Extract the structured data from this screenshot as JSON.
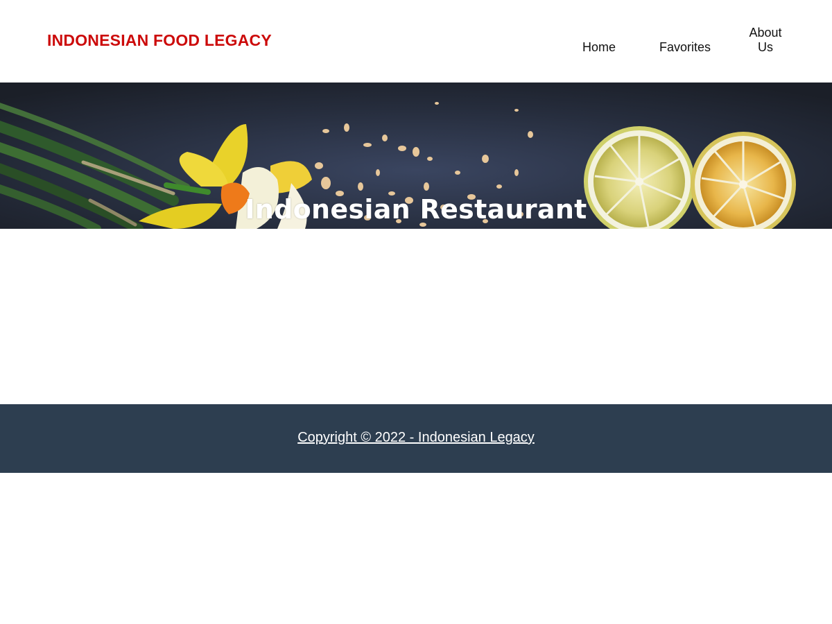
{
  "header": {
    "brand": "INDONESIAN FOOD LEGACY",
    "nav": {
      "home": "Home",
      "favorites": "Favorites",
      "about_line1": "About",
      "about_line2": "Us"
    }
  },
  "hero": {
    "title": "Indonesian Restaurant"
  },
  "footer": {
    "copyright": "Copyright © 2022 - Indonesian Legacy"
  },
  "colors": {
    "brand": "#cc0a0a",
    "footer_bg": "#2d3e50",
    "hero_bg": "#252c3a"
  }
}
